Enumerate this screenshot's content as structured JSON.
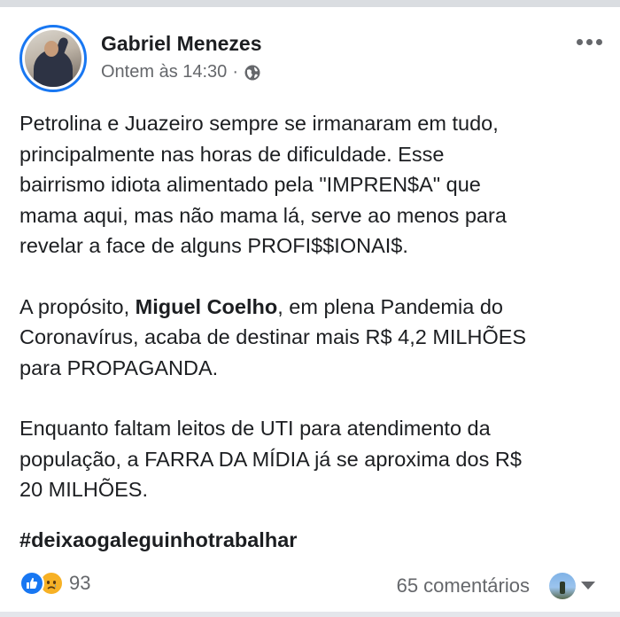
{
  "post": {
    "author": "Gabriel Menezes",
    "timestamp": "Ontem às 14:30",
    "separator": "·",
    "privacy_icon": "globe-icon",
    "more_icon": "more-options-icon",
    "paragraphs": [
      {
        "lines": [
          "Petrolina e Juazeiro sempre se irmanaram em tudo,",
          "principalmente nas horas de dificuldade. Esse",
          "bairrismo idiota alimentado pela \"IMPREN$A\" que",
          "mama aqui, mas não mama lá, serve ao menos para",
          "revelar a face de alguns PROFI$$IONAI$."
        ]
      },
      {
        "line1_prefix": "A propósito, ",
        "line1_bold": "Miguel Coelho",
        "line1_suffix": ", em plena Pandemia do",
        "line2": "Coronavírus, acaba de destinar mais R$ 4,2 MILHÕES",
        "line3": "para PROPAGANDA."
      },
      {
        "lines": [
          "Enquanto faltam leitos de UTI para atendimento da",
          "população, a FARRA DA MÍDIA já se aproxima dos R$",
          "20 MILHÕES."
        ]
      }
    ],
    "hashtag": "#deixaogaleguinhotrabalhar",
    "reactions": {
      "icons": [
        "like-icon",
        "sad-icon"
      ],
      "count": "93"
    },
    "comments_label": "65 comentários",
    "colors": {
      "accent": "#1877f2",
      "text": "#1c1e21",
      "secondary": "#65676b"
    }
  }
}
